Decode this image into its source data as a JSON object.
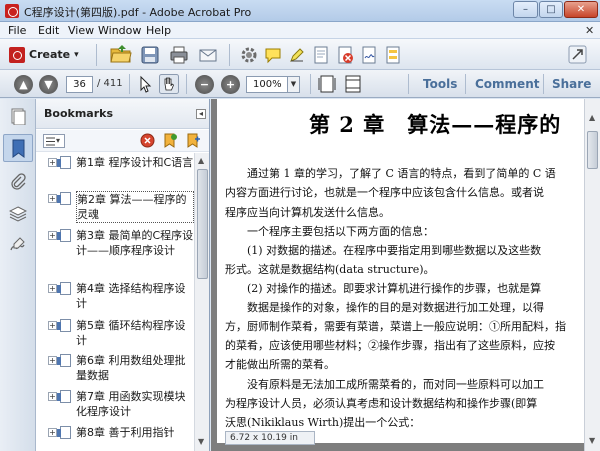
{
  "window": {
    "title": "C程序设计(第四版).pdf - Adobe Acrobat Pro",
    "min_glyph": "–",
    "max_glyph": "□",
    "close_glyph": "✕"
  },
  "menu": {
    "items": [
      "File",
      "Edit",
      "View",
      "Window",
      "Help"
    ],
    "close_glyph": "✕"
  },
  "toolbar": {
    "create_label": "Create",
    "create_arrow": "▾"
  },
  "nav": {
    "current_page": "36",
    "total_pages": "/ 411",
    "zoom": "100%",
    "zoom_arrow": "▼",
    "prev_glyph": "▲",
    "next_glyph": "▼",
    "zoom_out_glyph": "−",
    "zoom_in_glyph": "+",
    "tools_label": "Tools",
    "comment_label": "Comment",
    "share_label": "Share"
  },
  "bookmarks": {
    "title": "Bookmarks",
    "collapse_glyph": "◂",
    "options_glyph": "▾",
    "expand_glyph": "+",
    "items": [
      {
        "label": "第1章 程序设计和C语言"
      },
      {
        "label": "第2章 算法——程序的灵魂"
      },
      {
        "label": "第3章 最简单的C程序设计——顺序程序设计"
      },
      {
        "label": "第4章 选择结构程序设计"
      },
      {
        "label": "第5章 循环结构程序设计"
      },
      {
        "label": "第6章 利用数组处理批量数据"
      },
      {
        "label": "第7章 用函数实现模块化程序设计"
      },
      {
        "label": "第8章 善于利用指针"
      }
    ],
    "scroll_up": "▲",
    "scroll_down": "▼"
  },
  "document": {
    "chapter_title": "第 2 章　算法——程序的",
    "paragraphs": [
      "　　通过第 1 章的学习，了解了 C 语言的特点，看到了简单的 C 语",
      "内容方面进行讨论，也就是一个程序中应该包含什么信息。或者说",
      "程序应当向计算机发送什么信息。",
      "　　一个程序主要包括以下两方面的信息：",
      "　　(1) 对数据的描述。在程序中要指定用到哪些数据以及这些数",
      "形式。这就是数据结构(data structure)。",
      "　　(2) 对操作的描述。即要求计算机进行操作的步骤，也就是算",
      "　　数据是操作的对象，操作的目的是对数据进行加工处理，以得",
      "方，厨师制作菜肴，需要有菜谱，菜谱上一般应说明：①所用配料，指",
      "的菜肴，应该使用哪些材料；②操作步骤，指出有了这些原料，应按",
      "才能做出所需的菜肴。",
      "　　没有原料是无法加工成所需菜肴的，而对同一些原料可以加工",
      "为程序设计人员，必须认真考虑和设计数据结构和操作步骤(即算",
      "沃思(Nikiklaus Wirth)提出一个公式："
    ],
    "page_size": "6.72 x 10.19 in",
    "scroll_up": "▲",
    "scroll_down": "▼"
  },
  "colors": {
    "titlebar": "#c9dcf2",
    "link": "#4a6f9a",
    "close_button": "#c7452a"
  }
}
